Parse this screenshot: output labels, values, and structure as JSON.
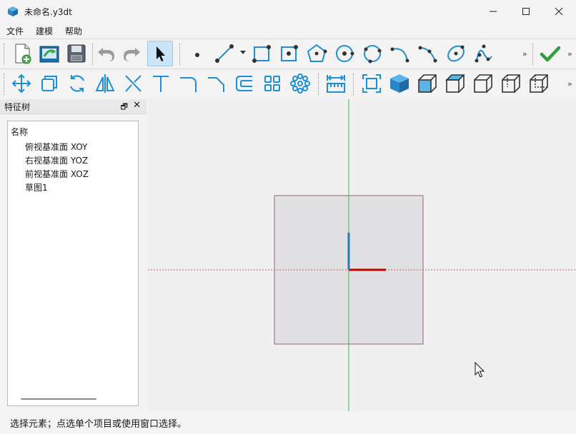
{
  "window": {
    "title": "未命名.y3dt",
    "minimize_icon": "minimize-icon",
    "maximize_icon": "maximize-icon",
    "close_icon": "close-icon"
  },
  "menu": {
    "items": [
      "文件",
      "建模",
      "帮助"
    ]
  },
  "toolbar1": {
    "icons": [
      "new-file-icon",
      "open-file-icon",
      "save-icon",
      "undo-icon",
      "redo-icon",
      "select-pointer-icon",
      "point-icon",
      "line-icon",
      "rectangle-icon",
      "center-rectangle-icon",
      "polygon-icon",
      "circle-icon",
      "circle-3point-icon",
      "arc-icon",
      "arc-3point-icon",
      "ellipse-icon",
      "spline-icon",
      "confirm-check-icon"
    ],
    "more_label": "»"
  },
  "toolbar2": {
    "icons": [
      "move-icon",
      "offset-icon",
      "rotate-icon",
      "mirror-icon",
      "trim-icon",
      "extend-icon",
      "fillet-icon",
      "chamfer-icon",
      "offset-curve-icon",
      "rect-array-icon",
      "circular-array-icon",
      "dimension-icon",
      "zoom-fit-icon",
      "view-iso-shaded-icon",
      "view-front-icon",
      "view-top-icon",
      "view-right-icon",
      "view-left-icon",
      "view-back-icon"
    ],
    "more_label": "»"
  },
  "feature_tree": {
    "panel_title": "特征树",
    "float_label": "🗗",
    "close_label": "✕",
    "header": "名称",
    "items": [
      "俯视基准面 XOY",
      "右视基准面 YOZ",
      "前视基准面 XOZ",
      "草图1"
    ]
  },
  "viewport": {
    "background": "#f0f0f0",
    "plane_fill": "#e1e0e2",
    "plane_border": "#8a6a70",
    "axis_x_color": "#c00000",
    "axis_y_color": "#2a7ab0",
    "axis_z_color": "#4caf50",
    "cursor_icon": "mouse-cursor-icon"
  },
  "status": {
    "text": "选择元素；点选单个项目或使用窗口选择。"
  },
  "colors": {
    "accent": "#1e8fd5",
    "check": "#2e9e3e"
  }
}
